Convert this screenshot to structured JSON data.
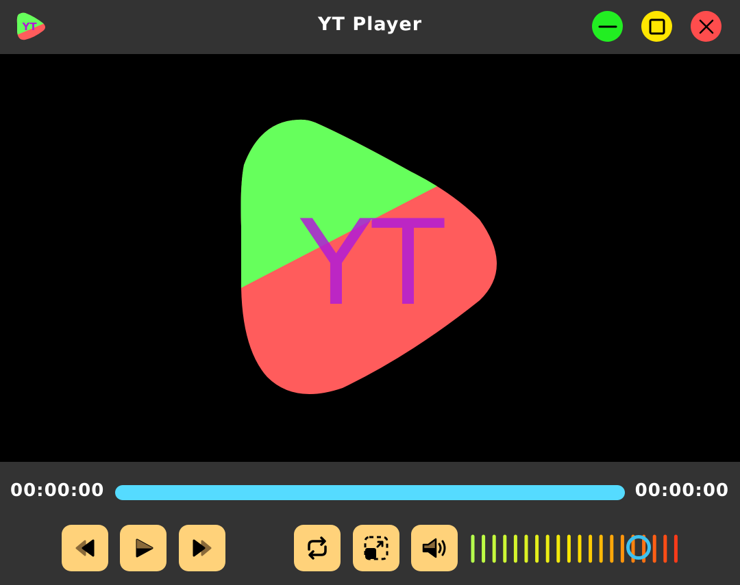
{
  "window": {
    "title": "YT Player",
    "logo_text": "YT",
    "logo_icon": "yt-player-logo-icon",
    "minimize_icon": "minus-icon",
    "maximize_icon": "square-icon",
    "close_icon": "close-icon"
  },
  "video": {
    "logo_text": "YT",
    "logo_colors": {
      "top": "#66ff5c",
      "bottom": "#ff5c5c",
      "text": "#b01cd6"
    }
  },
  "playback": {
    "current_time": "00:00:00",
    "total_time": "00:00:00",
    "progress_color": "#55dbff"
  },
  "controls": {
    "prev_icon": "rewind-icon",
    "play_icon": "play-icon",
    "next_icon": "fast-forward-icon",
    "loop_icon": "repeat-icon",
    "fullscreen_icon": "fullscreen-icon",
    "volume_icon": "speaker-icon"
  },
  "volume": {
    "level": 0.8,
    "bars": 20,
    "gradient": [
      "#b6ff4d",
      "#ffe600",
      "#ff3b1a"
    ],
    "knob_color": "#3cc2f0"
  },
  "colors": {
    "background": "#333333",
    "button_fill": "#ffd27a",
    "minimize": "#22ee22",
    "maximize": "#ffe600",
    "close": "#ff4d4d"
  }
}
